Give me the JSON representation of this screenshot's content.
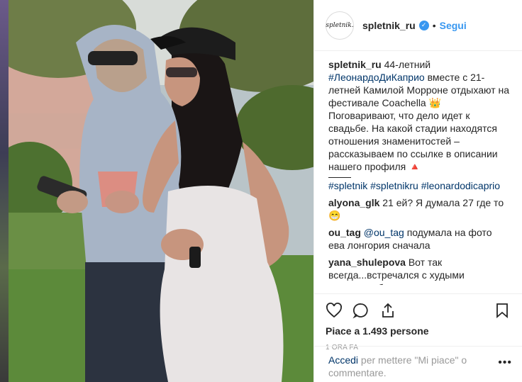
{
  "post": {
    "username": "spletnik_ru",
    "avatar_text": "spletnik.",
    "follow_label": "Segui",
    "dot": "•"
  },
  "caption": {
    "username": "spletnik_ru",
    "text_part1": " 44-летний ",
    "hashtag_main": "#ЛеонардоДиКаприо",
    "text_part2": " вместе с 21-летней Камилой Морроне отдыхают на фестивале Coachella 👑 Поговаривают, что дело идет к свадьбе. На какой стадии находятся отношения знаменитостей – рассказываем по ссылке в описании нашего профиля 🔺",
    "hashtags": "#spletnik #spletnikru #leonardodicaprio"
  },
  "comments": [
    {
      "username": "alyona_glk",
      "text": " 21 ей? Я думала 27 где то 😁"
    },
    {
      "username": "ou_tag",
      "mention": " @ou_tag",
      "text": " подумала на фото ева лонгория сначала"
    },
    {
      "username": "yana_shulepova",
      "text": " Вот так всегда...встречался с худыми моделями блондинками , а женится на брюнетке с пышными формами 😅"
    }
  ],
  "actions": {
    "likes": "Piace a 1.493 persone",
    "time": "1 ORA FA"
  },
  "login": {
    "link": "Accedi",
    "text": " per mettere \"Mi piace\" o commentare.",
    "dots": "•••"
  },
  "icons": {
    "like": "heart-icon",
    "comment": "comment-icon",
    "share": "share-icon",
    "save": "bookmark-icon",
    "verified": "verified-icon"
  },
  "colors": {
    "accent": "#3897f0",
    "link": "#003569",
    "muted": "#999999"
  }
}
